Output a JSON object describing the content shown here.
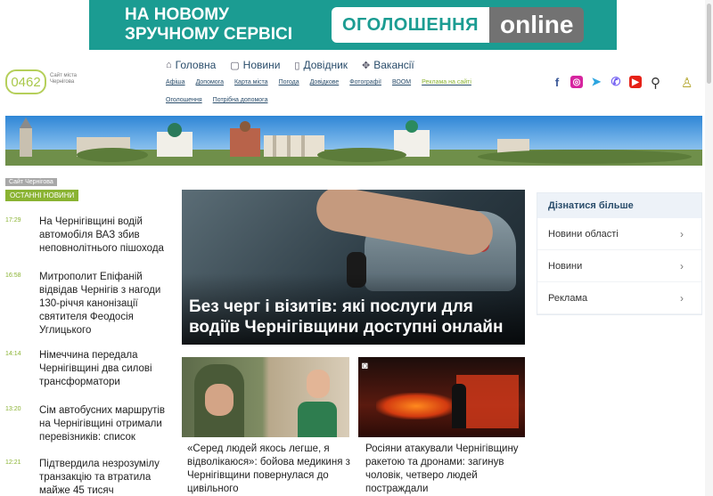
{
  "banner": {
    "line1": "НА НОВОМУ",
    "line2": "ЗРУЧНОМУ СЕРВІСІ",
    "pill_left": "ОГОЛОШЕННЯ",
    "pill_right": "online"
  },
  "logo": {
    "text": "0462",
    "subtitle": "Сайт міста Чернігова"
  },
  "main_nav": [
    {
      "label": "Головна",
      "icon": "home-icon"
    },
    {
      "label": "Новини",
      "icon": "chat-icon"
    },
    {
      "label": "Довідник",
      "icon": "book-icon"
    },
    {
      "label": "Вакансії",
      "icon": "briefcase-icon"
    }
  ],
  "sub_nav": [
    "Афіша",
    "Допомога",
    "Карта міста",
    "Погода",
    "Довідкове",
    "Фотографії",
    "ВООМ",
    "Реклама на сайті"
  ],
  "sub_nav2": [
    "Оголошення",
    "Потрібна допомога"
  ],
  "social": [
    {
      "name": "facebook-icon",
      "glyph": "f",
      "color": "#3b5998"
    },
    {
      "name": "instagram-icon",
      "glyph": "◎",
      "color": "#d6249f"
    },
    {
      "name": "telegram-icon",
      "glyph": "➤",
      "color": "#2ca5e0"
    },
    {
      "name": "viber-icon",
      "glyph": "✆",
      "color": "#7360f2"
    },
    {
      "name": "youtube-icon",
      "glyph": "▶",
      "color": "#e62117"
    }
  ],
  "left": {
    "site_chip": "Сайт Чернігова",
    "latest_label": "ОСТАННІ НОВИНИ",
    "news": [
      {
        "time": "17:29",
        "title": "На Чернігівщині водій автомобіля ВАЗ збив неповнолітнього пішохода"
      },
      {
        "time": "16:58",
        "title": "Митрополит Епіфаній відвідав Чернігів з нагоди 130-річчя канонізації святителя Феодосія Углицького"
      },
      {
        "time": "14:14",
        "title": "Німеччина передала Чернігівщині два силові трансформатори"
      },
      {
        "time": "13:20",
        "title": "Сім автобусних маршрутів на Чернігівщині отримали перевізників: список"
      },
      {
        "time": "12:21",
        "title": "Підтвердила незрозумілу транзакцію та втратила майже 45 тисяч"
      }
    ]
  },
  "hero": {
    "title": "Без черг і візитів: які послуги для водіїв Чернігівщини доступні онлайн"
  },
  "cards": [
    {
      "title": "«Серед людей якось легше, я відволікаюся»: бойова медикиня з Чернігівщини повернулася до цивільного"
    },
    {
      "title": "Росіяни атакували Чернігівщину ракетою та дронами: загинув чоловік, четверо людей постраждали"
    }
  ],
  "panel": {
    "title": "Дізнатися більше",
    "items": [
      "Новини області",
      "Новини",
      "Реклама"
    ]
  }
}
